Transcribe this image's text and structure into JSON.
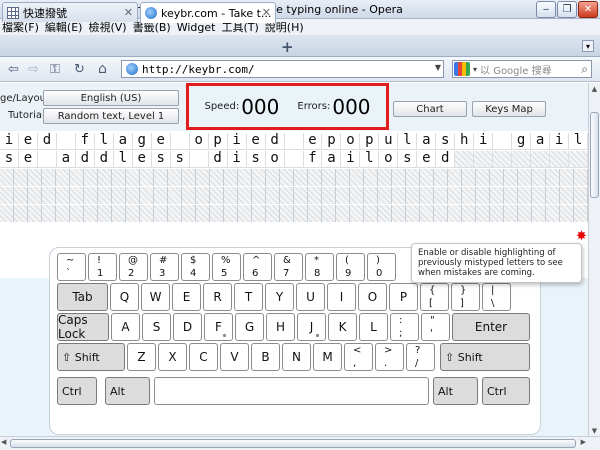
{
  "window": {
    "title": "keybr.com - Take typing speed test and practice typing online - Opera",
    "minimize": "‒",
    "maximize": "❐",
    "close": "✕"
  },
  "menu": [
    "檔案(F)",
    "編輯(E)",
    "檢視(V)",
    "書籤(B)",
    "Widget",
    "工具(T)",
    "說明(H)"
  ],
  "tabs": [
    {
      "label": "快速撥號",
      "close": "✕"
    },
    {
      "label": "keybr.com - Take t...",
      "close": "✕"
    }
  ],
  "new_tab": "+",
  "toolbar": {
    "back": "⇦",
    "forward": "⇨",
    "key": "⚿",
    "reload": "↻",
    "home": "⌂",
    "url": "http://keybr.com/",
    "search_placeholder": "以 Google 搜尋",
    "search_icon": "magnifier-icon"
  },
  "controls": {
    "layout_label": "ge/Layout:",
    "layout_value": "English (US)",
    "tutorial_label": "Tutorial:",
    "tutorial_value": "Random text, Level 1",
    "speed_label": "Speed:",
    "speed_value": "000",
    "errors_label": "Errors:",
    "errors_value": "000",
    "chart_button": "Chart",
    "keysmap_button": "Keys Map"
  },
  "text_lines": [
    [
      "i",
      "e",
      "d",
      " ",
      "f",
      "l",
      "a",
      "g",
      "e",
      " ",
      "o",
      "p",
      "i",
      "e",
      "d",
      " ",
      "e",
      "p",
      "o",
      "p",
      "u",
      "l",
      "a",
      "s",
      "h",
      "i",
      " ",
      "g",
      "a",
      "i",
      "l"
    ],
    [
      "s",
      "e",
      " ",
      "a",
      "d",
      "d",
      "l",
      "e",
      "s",
      "s",
      " ",
      "d",
      "i",
      "s",
      "o",
      " ",
      "f",
      "a",
      "i",
      "l",
      "o",
      "s",
      "e",
      "d",
      "",
      "",
      "",
      "",
      "",
      "",
      ""
    ]
  ],
  "tooltip": "Enable or disable highlighting of previously mistyped letters to see when mistakes are coming.",
  "highlight_color": "#e21b1b",
  "keyboard": {
    "row1": [
      {
        "up": "~",
        "lo": "`"
      },
      {
        "up": "!",
        "lo": "1"
      },
      {
        "up": "@",
        "lo": "2"
      },
      {
        "up": "#",
        "lo": "3"
      },
      {
        "up": "$",
        "lo": "4"
      },
      {
        "up": "%",
        "lo": "5"
      },
      {
        "up": "^",
        "lo": "6"
      },
      {
        "up": "&",
        "lo": "7"
      },
      {
        "up": "*",
        "lo": "8"
      },
      {
        "up": "(",
        "lo": "9"
      },
      {
        "up": ")",
        "lo": "0"
      }
    ],
    "tab": "Tab",
    "row2": [
      "Q",
      "W",
      "E",
      "R",
      "T",
      "Y",
      "U",
      "I",
      "O",
      "P"
    ],
    "row2_extra": [
      {
        "up": "{",
        "lo": "["
      },
      {
        "up": "}",
        "lo": "]"
      },
      {
        "up": "|",
        "lo": "\\"
      }
    ],
    "caps": "Caps Lock",
    "row3": [
      "A",
      "S",
      "D",
      "F",
      "G",
      "H",
      "J",
      "K",
      "L"
    ],
    "row3_extra": [
      {
        "up": ":",
        "lo": ";"
      },
      {
        "up": "\"",
        "lo": "'"
      }
    ],
    "enter": "Enter",
    "shift": "Shift",
    "row4": [
      "Z",
      "X",
      "C",
      "V",
      "B",
      "N",
      "M"
    ],
    "row4_extra": [
      {
        "up": "<",
        "lo": ","
      },
      {
        "up": ">",
        "lo": "."
      },
      {
        "up": "?",
        "lo": "/"
      }
    ],
    "ctrl": "Ctrl",
    "alt": "Alt"
  }
}
